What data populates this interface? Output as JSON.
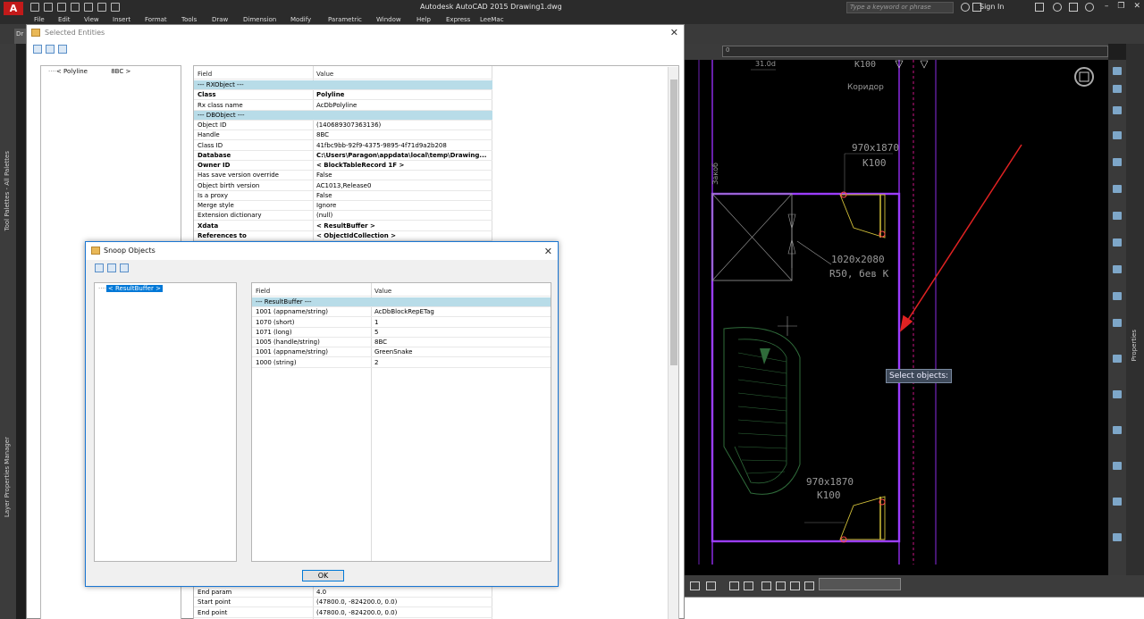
{
  "app": {
    "title": "Autodesk AutoCAD 2015    Drawing1.dwg",
    "logo": "A",
    "search_placeholder": "Type a keyword or phrase",
    "sign_in": "Sign In",
    "doc_tab": "Dr"
  },
  "menu": [
    "File",
    "Edit",
    "View",
    "Insert",
    "Format",
    "Tools",
    "Draw",
    "Dimension",
    "Modify",
    "Parametric",
    "Window",
    "Help",
    "Express",
    "LeeMac"
  ],
  "palettes": {
    "tool_palettes": "Tool Palettes - All Palettes",
    "layer_manager": "Layer Properties Manager",
    "properties": "Properties"
  },
  "canvas": {
    "combo_value": "0",
    "prompt": "Select objects:",
    "labels": {
      "k100_top": "K100",
      "room_num": "31.0d",
      "corridor": "Коридор",
      "door1_size": "970x1870",
      "door1_code": "K100",
      "niche": "Закоб",
      "door2_size": "1020x2080",
      "door2_code": "R50, бев K",
      "door3_size": "970x1870",
      "door3_code": "K100"
    }
  },
  "selected_entities": {
    "title": "Selected Entities",
    "tree_node": "< Polyline",
    "tree_handle": "8BC >",
    "columns": [
      "Field",
      "Value"
    ],
    "rows": [
      {
        "f": "--- RXObject ---",
        "v": "",
        "type": "cat"
      },
      {
        "f": "Class",
        "v": "Polyline",
        "type": "bold"
      },
      {
        "f": "Rx class name",
        "v": "AcDbPolyline",
        "type": ""
      },
      {
        "f": "--- DBObject ---",
        "v": "",
        "type": "cat"
      },
      {
        "f": "Object ID",
        "v": "(140689307363136)",
        "type": ""
      },
      {
        "f": "Handle",
        "v": "8BC",
        "type": ""
      },
      {
        "f": "Class ID",
        "v": "41fbc9bb-92f9-4375-9895-4f71d9a2b208",
        "type": ""
      },
      {
        "f": "Database",
        "v": "C:\\Users\\Paragon\\appdata\\local\\temp\\Drawing...",
        "type": "bold"
      },
      {
        "f": "Owner ID",
        "v": "< BlockTableRecord       1F >",
        "type": "bold"
      },
      {
        "f": "Has save version override",
        "v": "False",
        "type": ""
      },
      {
        "f": "Object birth version",
        "v": "AC1013,Release0",
        "type": ""
      },
      {
        "f": "Is a proxy",
        "v": "False",
        "type": ""
      },
      {
        "f": "Merge style",
        "v": "Ignore",
        "type": ""
      },
      {
        "f": "Extension dictionary",
        "v": "(null)",
        "type": ""
      },
      {
        "f": "Xdata",
        "v": "< ResultBuffer >",
        "type": "bold"
      },
      {
        "f": "References to",
        "v": "< ObjectIdCollection >",
        "type": "bold"
      }
    ],
    "bottom_rows": [
      {
        "f": "End param",
        "v": "4.0"
      },
      {
        "f": "Start point",
        "v": "(47800.0, -824200.0, 0.0)"
      },
      {
        "f": "End point",
        "v": "(47800.0, -824200.0, 0.0)"
      }
    ]
  },
  "snoop": {
    "title": "Snoop Objects",
    "tree_node": "< ResultBuffer >",
    "columns": [
      "Field",
      "Value"
    ],
    "rows": [
      {
        "f": "--- ResultBuffer ---",
        "v": "",
        "type": "cat"
      },
      {
        "f": "1001    (appname/string)",
        "v": "AcDbBlockRepETag",
        "type": ""
      },
      {
        "f": "1070    (short)",
        "v": "1",
        "type": ""
      },
      {
        "f": "1071    (long)",
        "v": "5",
        "type": ""
      },
      {
        "f": "1005    (handle/string)",
        "v": "8BC",
        "type": ""
      },
      {
        "f": "1001    (appname/string)",
        "v": "GreenSnake",
        "type": ""
      },
      {
        "f": "1000    (string)",
        "v": "2",
        "type": ""
      }
    ],
    "ok_label": "OK"
  }
}
